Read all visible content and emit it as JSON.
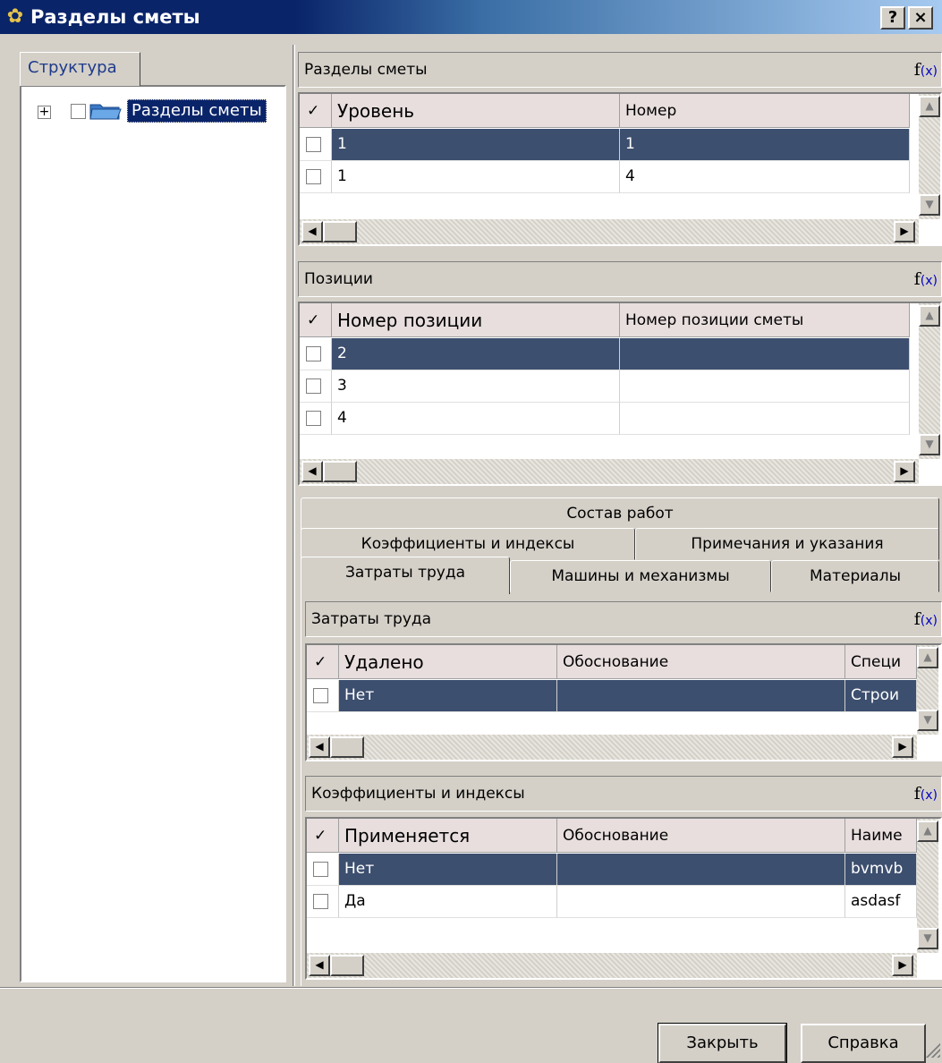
{
  "window": {
    "title": "Разделы сметы",
    "help_btn": "?",
    "close_btn": "×"
  },
  "left": {
    "tab_label": "Структура",
    "tree_root_label": "Разделы сметы",
    "expander": "+"
  },
  "fx_label": "f",
  "fx_x": "(x)",
  "sections": {
    "title": "Разделы сметы",
    "columns": [
      "Уровень",
      "Номер"
    ],
    "rows": [
      {
        "level": "1",
        "number": "1"
      },
      {
        "level": "1",
        "number": "4"
      }
    ]
  },
  "positions": {
    "title": "Позиции",
    "columns": [
      "Номер позиции",
      "Номер позиции сметы"
    ],
    "rows": [
      {
        "num": "2",
        "estimate_num": ""
      },
      {
        "num": "3",
        "estimate_num": ""
      },
      {
        "num": "4",
        "estimate_num": ""
      }
    ]
  },
  "tabs": {
    "row1": [
      "Состав работ"
    ],
    "row2": [
      "Коэффициенты и индексы",
      "Примечания и указания"
    ],
    "row3": [
      "Затраты труда",
      "Машины и механизмы",
      "Материалы"
    ],
    "active": "Затраты труда"
  },
  "labor": {
    "title": "Затраты труда",
    "columns": [
      "Удалено",
      "Обоснование",
      "Специ"
    ],
    "rows": [
      {
        "deleted": "Нет",
        "basis": "",
        "spec": "Строи"
      }
    ]
  },
  "coef": {
    "title": "Коэффициенты и индексы",
    "columns": [
      "Применяется",
      "Обоснование",
      "Наиме"
    ],
    "rows": [
      {
        "applied": "Нет",
        "basis": "",
        "name": "bvmvb"
      },
      {
        "applied": "Да",
        "basis": "",
        "name": "asdasf"
      }
    ]
  },
  "check_header": "✓",
  "buttons": {
    "close": "Закрыть",
    "help": "Справка"
  },
  "colors": {
    "title_bar": "#0a246a",
    "selection": "#3d4f6f",
    "face": "#d4d0c8",
    "column_header": "#e8dede"
  }
}
